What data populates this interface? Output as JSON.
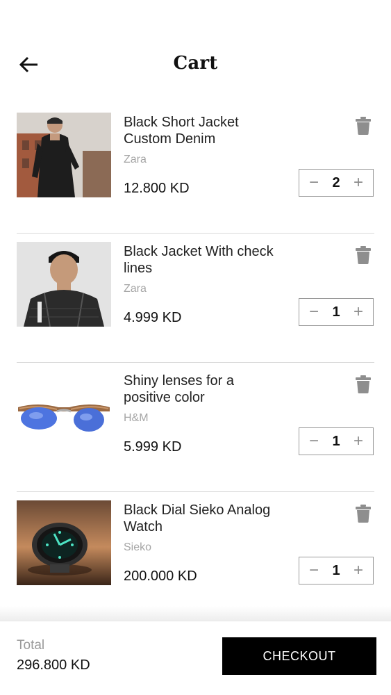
{
  "header": {
    "title": "Cart",
    "back_icon": "arrow-left-icon"
  },
  "items": [
    {
      "name": "Black Short Jacket Custom Denim",
      "brand": "Zara",
      "price": "12.800 KD",
      "quantity": "2"
    },
    {
      "name": "Black Jacket With check lines",
      "brand": "Zara",
      "price": "4.999 KD",
      "quantity": "1"
    },
    {
      "name": "Shiny lenses for a positive color",
      "brand": "H&M",
      "price": "5.999 KD",
      "quantity": "1"
    },
    {
      "name": "Black Dial Sieko Analog Watch",
      "brand": "Sieko",
      "price": "200.000 KD",
      "quantity": "1"
    }
  ],
  "stepper": {
    "minus": "−",
    "plus": "+"
  },
  "footer": {
    "total_label": "Total",
    "total_value": "296.800 KD",
    "checkout_label": "CHECKOUT"
  },
  "colors": {
    "accent": "#000000",
    "muted_text": "#a5a5a5",
    "divider": "#d9d9d9"
  }
}
